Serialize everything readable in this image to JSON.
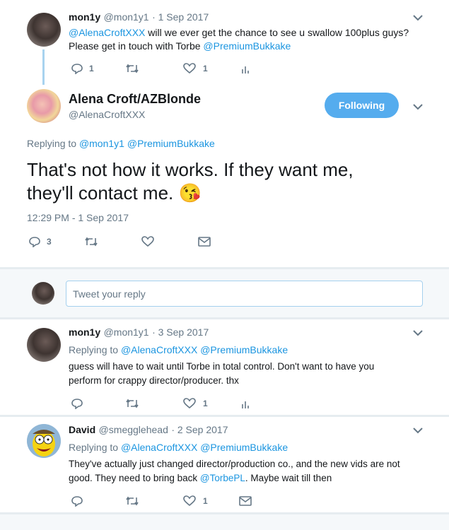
{
  "parent_tweet": {
    "name": "mon1y",
    "handle": "@mon1y1",
    "date": "· 1 Sep 2017",
    "mention": "@AlenaCroftXXX",
    "text_line1": "will we ever get the chance to see u swallow 100plus guys?",
    "text_line2": "Please get in touch with Torbe",
    "mention2": "@PremiumBukkake",
    "reply_count": "1",
    "like_count": "1"
  },
  "main_tweet": {
    "name": "Alena Croft/AZBlonde",
    "handle": "@AlenaCroftXXX",
    "follow_label": "Following",
    "replying_to_label": "Replying to",
    "replying_to_1": "@mon1y1",
    "replying_to_2": "@PremiumBukkake",
    "text_line1": "That's not how it works. If they want me,",
    "text_line2": "they'll contact me.",
    "emoji": "😘",
    "timestamp": "12:29 PM - 1 Sep 2017",
    "reply_count": "3"
  },
  "reply_composer": {
    "placeholder": "Tweet your reply"
  },
  "replies": [
    {
      "name": "mon1y",
      "handle": "@mon1y1",
      "date": "· 3 Sep 2017",
      "replying_to_label": "Replying to",
      "replying_to_1": "@AlenaCroftXXX",
      "replying_to_2": "@PremiumBukkake",
      "text_line1": "guess will have to wait until Torbe in total control. Don't want to have you",
      "text_line2": "perform for crappy director/producer. thx",
      "like_count": "1"
    },
    {
      "name": "David",
      "handle": "@smegglehead",
      "date": "· 2 Sep 2017",
      "replying_to_label": "Replying to",
      "replying_to_1": "@AlenaCroftXXX",
      "replying_to_2": "@PremiumBukkake",
      "text_line1": "They've actually just changed director/production co., and the new vids are not",
      "text_line2_pre": "good. They need to bring back",
      "text_line2_link": "@TorbePL",
      "text_line2_post": ". Maybe wait till then",
      "like_count": "1"
    }
  ],
  "colors": {
    "link": "#1b95e0",
    "follow_button": "#55acee",
    "muted": "#657786",
    "background": "#e6ecf0"
  }
}
